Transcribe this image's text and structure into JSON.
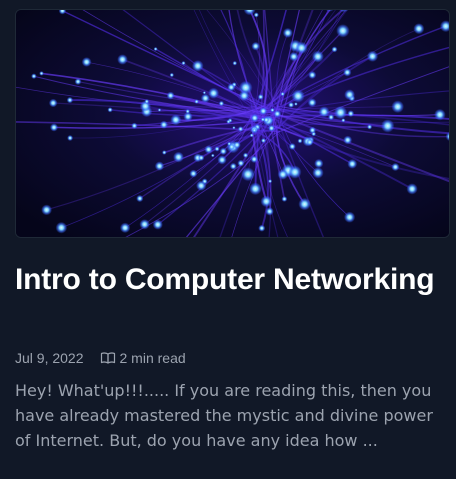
{
  "post": {
    "title": "Intro to Computer Networking",
    "date": "Jul 9, 2022",
    "read_time": "2 min read",
    "excerpt": "Hey! What'up!!!..... If you are reading this, then you have already mastered the mystic and divine power of Internet. But, do you have any idea how ..."
  },
  "cover": {
    "icon": "fiber-optic-cover-image",
    "colors": {
      "background": "#0b0a2a",
      "glow": "#3b6cff",
      "strand": "#4b2ad6",
      "highlight": "#7fd8ff"
    }
  },
  "icons": {
    "read_time": "book-icon"
  }
}
